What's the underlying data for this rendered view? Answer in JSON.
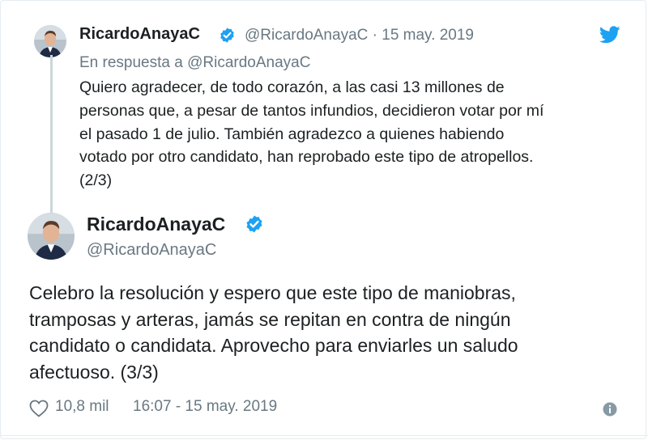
{
  "reply_tweet": {
    "name": "RicardoAnayaC",
    "handle": "@RicardoAnayaC",
    "separator": "·",
    "date": "15 may. 2019",
    "reply_prefix": "En respuesta a",
    "reply_handle": "@RicardoAnayaC",
    "text_lines": [
      "Quiero agradecer, de todo corazón, a las casi 13 millones de",
      "personas que, a pesar de tantos infundios, decidieron votar por mí",
      "el pasado 1 de julio. También agradezco a quienes habiendo",
      "votado por otro candidato, han reprobado este tipo de atropellos.",
      "(2/3)"
    ]
  },
  "main_tweet": {
    "name": "RicardoAnayaC",
    "handle": "@RicardoAnayaC",
    "text_lines": [
      "Celebro la resolución y espero que este tipo de maniobras,",
      "tramposas y arteras, jamás se repitan en contra de ningún",
      "candidato o candidata. Aprovecho para enviarles un saludo",
      "afectuoso. (3/3)"
    ],
    "likes": "10,8 mil",
    "timestamp": "16:07 - 15 may. 2019"
  },
  "icons": {
    "verified": "verified-badge-icon",
    "twitter": "twitter-bird-icon",
    "heart": "heart-icon",
    "info": "info-icon"
  },
  "colors": {
    "twitter_blue": "#1da1f2",
    "text": "#1c2022",
    "muted": "#697882",
    "thread_line": "#ccd6dd"
  }
}
